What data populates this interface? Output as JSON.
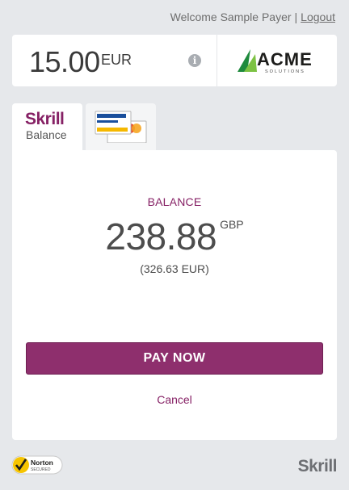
{
  "header": {
    "welcome_text": "Welcome Sample Payer",
    "separator": "|",
    "logout_label": "Logout"
  },
  "payment": {
    "amount": "15.00",
    "currency": "EUR",
    "info_icon": "info-icon",
    "merchant_logo_text": "ACME",
    "merchant_logo_subtext": "SOLUTIONS"
  },
  "tabs": [
    {
      "brand": "Skrill",
      "label": "Balance",
      "selected": true
    },
    {
      "icon": "credit-card-icon",
      "selected": false
    }
  ],
  "balance": {
    "heading": "BALANCE",
    "value": "238.88",
    "currency": "GBP",
    "converted": "(326.63 EUR)"
  },
  "actions": {
    "pay_label": "PAY NOW",
    "cancel_label": "Cancel"
  },
  "footer": {
    "norton_text": "Norton",
    "norton_subtext": "SECURED",
    "brand": "Skrill"
  },
  "colors": {
    "brand_purple": "#862165",
    "pay_button": "#8e2f6d",
    "background": "#e6e8eb",
    "acme_green": "#7cc242"
  }
}
